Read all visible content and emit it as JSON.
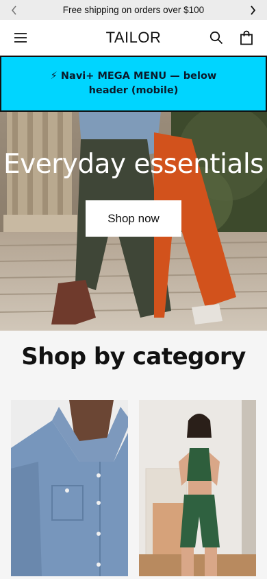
{
  "announcement": {
    "text": "Free shipping on orders over $100"
  },
  "header": {
    "logo": "TAILOR"
  },
  "mega_menu": {
    "text": "⚡ Navi+ MEGA MENU — below header (mobile)",
    "color": "#00d5ff"
  },
  "hero": {
    "heading": "Everyday essentials",
    "cta_label": "Shop now"
  },
  "categories": {
    "title": "Shop by category"
  },
  "icons": [
    "chevron-left-icon",
    "chevron-right-icon",
    "menu-icon",
    "search-icon",
    "bag-icon"
  ]
}
